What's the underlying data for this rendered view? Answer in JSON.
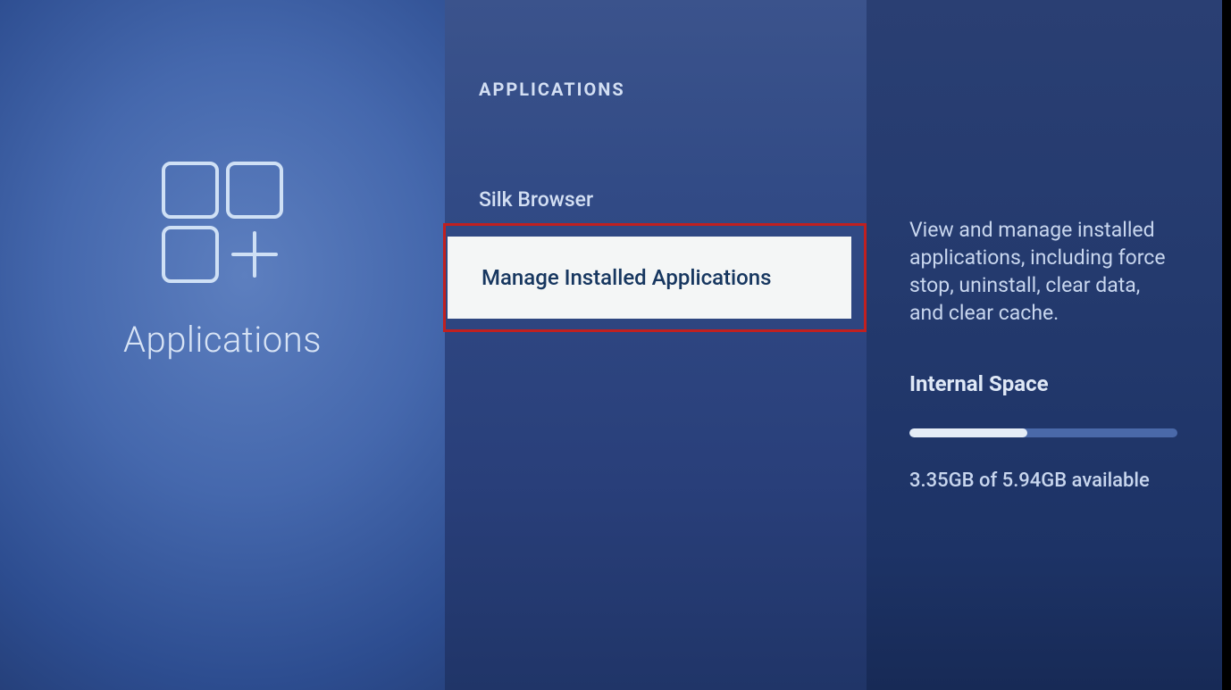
{
  "left": {
    "title": "Applications"
  },
  "middle": {
    "header": "APPLICATIONS",
    "items": [
      {
        "label": "Silk Browser",
        "selected": false
      },
      {
        "label": "Manage Installed Applications",
        "selected": true
      }
    ]
  },
  "right": {
    "description": "View and manage installed applications, including force stop, uninstall, clear data, and clear cache.",
    "section_title": "Internal Space",
    "storage_used_gb": 3.35,
    "storage_total_gb": 5.94,
    "storage_text": "3.35GB of 5.94GB available",
    "storage_fill_percent": 44
  },
  "annotation": {
    "highlight_color": "#c02020"
  }
}
